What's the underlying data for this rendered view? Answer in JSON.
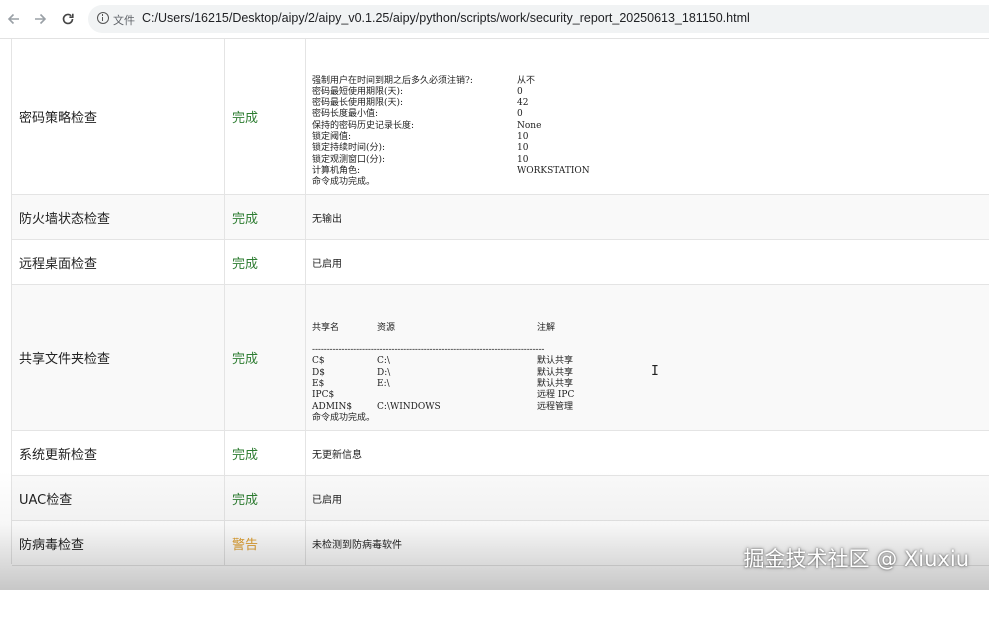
{
  "browser": {
    "file_label": "文件",
    "url": "C:/Users/16215/Desktop/aipy/2/aipy_v0.1.25/aipy/python/scripts/work/security_report_20250613_181150.html"
  },
  "rows": [
    {
      "name": "密码策略检查",
      "status": "完成",
      "status_color": "#2e7d32",
      "detail_lines": [
        {
          "label": "强制用户在时间到期之后多久必须注销?:",
          "value": "从不"
        },
        {
          "label": "密码最短使用期限(天):",
          "value": "0"
        },
        {
          "label": "密码最长使用期限(天):",
          "value": "42"
        },
        {
          "label": "密码长度最小值:",
          "value": "0"
        },
        {
          "label": "保持的密码历史记录长度:",
          "value": "None"
        },
        {
          "label": "锁定阈值:",
          "value": "10"
        },
        {
          "label": "锁定持续时间(分):",
          "value": "10"
        },
        {
          "label": "锁定观测窗口(分):",
          "value": "10"
        },
        {
          "label": "计算机角色:",
          "value": "WORKSTATION"
        },
        {
          "label": "命令成功完成。",
          "value": ""
        }
      ]
    },
    {
      "name": "防火墙状态检查",
      "status": "完成",
      "status_color": "#2e7d32",
      "detail": "无输出"
    },
    {
      "name": "远程桌面检查",
      "status": "完成",
      "status_color": "#2e7d32",
      "detail": "已启用"
    },
    {
      "name": "共享文件夹检查",
      "status": "完成",
      "status_color": "#2e7d32",
      "share_header": [
        "共享名",
        "资源",
        "注解"
      ],
      "separator": "-------------------------------------------------------------------------------",
      "shares": [
        {
          "name": "C$",
          "resource": "C:\\",
          "note": "默认共享"
        },
        {
          "name": "D$",
          "resource": "D:\\",
          "note": "默认共享"
        },
        {
          "name": "E$",
          "resource": "E:\\",
          "note": "默认共享"
        },
        {
          "name": "IPC$",
          "resource": "",
          "note": "远程 IPC"
        },
        {
          "name": "ADMIN$",
          "resource": "C:\\WINDOWS",
          "note": "远程管理"
        }
      ],
      "footer": "命令成功完成。"
    },
    {
      "name": "系统更新检查",
      "status": "完成",
      "status_color": "#2e7d32",
      "detail": "无更新信息"
    },
    {
      "name": "UAC检查",
      "status": "完成",
      "status_color": "#2e7d32",
      "detail": "已启用"
    },
    {
      "name": "防病毒检查",
      "status": "警告",
      "status_color": "#e0a030",
      "detail": "未检测到防病毒软件"
    }
  ],
  "watermark": "掘金技术社区 @ Xiuxiu"
}
